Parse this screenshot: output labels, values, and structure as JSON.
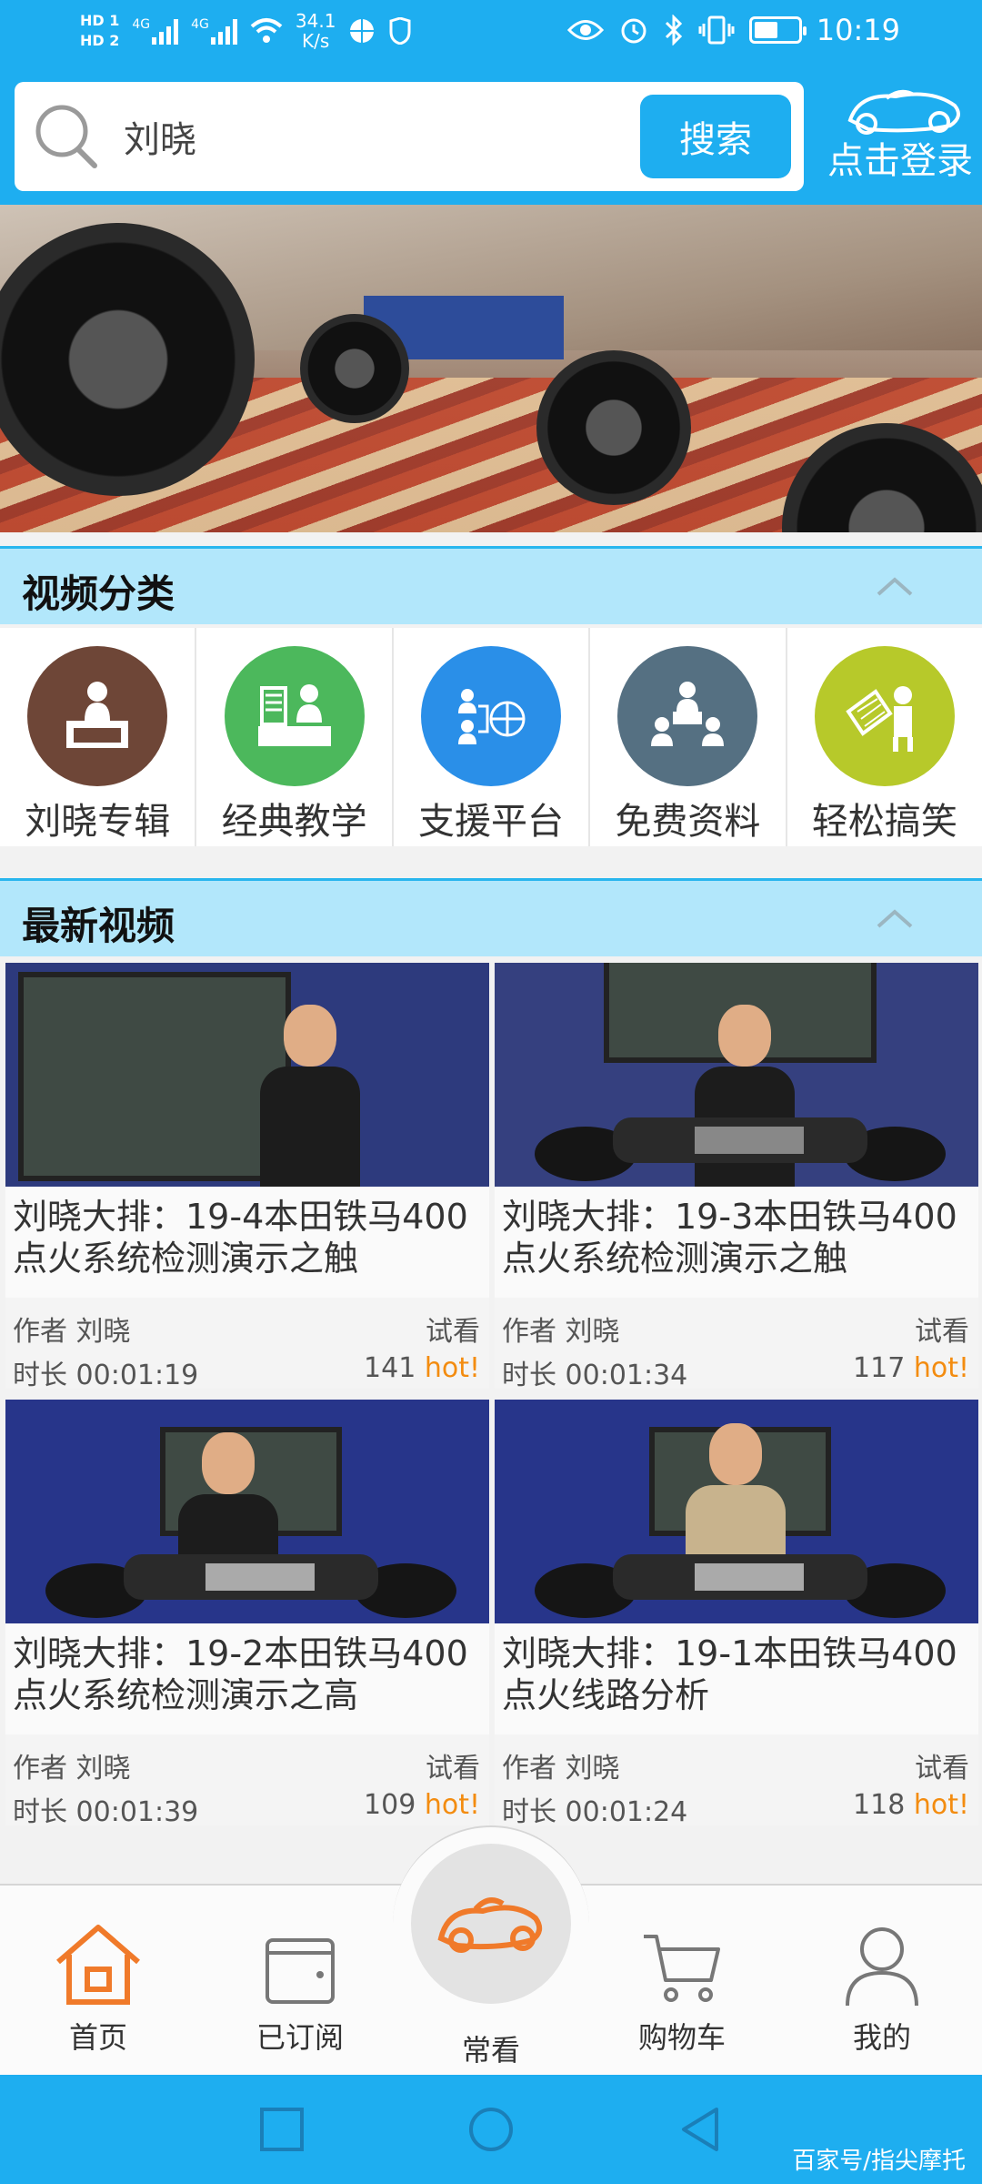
{
  "status_bar": {
    "hd1": "HD 1",
    "hd2": "HD 2",
    "net1": "4G",
    "net2": "4G",
    "speed_value": "34.1",
    "speed_unit": "K/s",
    "time": "10:19",
    "battery_level": 0.55
  },
  "search": {
    "value": "刘晓",
    "button_label": "搜索"
  },
  "login": {
    "label": "点击登录"
  },
  "banner": {
    "slide_count": 5,
    "active_slide": 0
  },
  "categories_section": {
    "title": "视频分类",
    "items": [
      {
        "label": "刘晓专辑",
        "icon": "lecturer-desk-icon",
        "color": "#6e4637"
      },
      {
        "label": "经典教学",
        "icon": "bank-teller-icon",
        "color": "#4cb85c"
      },
      {
        "label": "支援平台",
        "icon": "network-globe-icon",
        "color": "#2a8fe8"
      },
      {
        "label": "免费资料",
        "icon": "meeting-icon",
        "color": "#557082"
      },
      {
        "label": "轻松搞笑",
        "icon": "presentation-board-icon",
        "color": "#b7c92a"
      }
    ]
  },
  "latest_section": {
    "title": "最新视频",
    "videos": [
      {
        "title": "刘晓大排：19-4本田铁马400点火系统检测演示之触",
        "author_label": "作者 刘晓",
        "trial": "试看",
        "duration": "时长 00:01:19",
        "views": "141",
        "hot": "hot!"
      },
      {
        "title": "刘晓大排：19-3本田铁马400点火系统检测演示之触",
        "author_label": "作者 刘晓",
        "trial": "试看",
        "duration": "时长 00:01:34",
        "views": "117",
        "hot": "hot!"
      },
      {
        "title": "刘晓大排：19-2本田铁马400点火系统检测演示之高",
        "author_label": "作者 刘晓",
        "trial": "试看",
        "duration": "时长 00:01:39",
        "views": "109",
        "hot": "hot!"
      },
      {
        "title": "刘晓大排：19-1本田铁马400点火线路分析",
        "author_label": "作者 刘晓",
        "trial": "试看",
        "duration": "时长 00:01:24",
        "views": "118",
        "hot": "hot!"
      }
    ]
  },
  "bottom_nav": {
    "home": "首页",
    "subscribed": "已订阅",
    "frequent": "常看",
    "cart": "购物车",
    "mine": "我的",
    "active_color": "#f07a2a"
  },
  "watermark": "百家号/指尖摩托"
}
